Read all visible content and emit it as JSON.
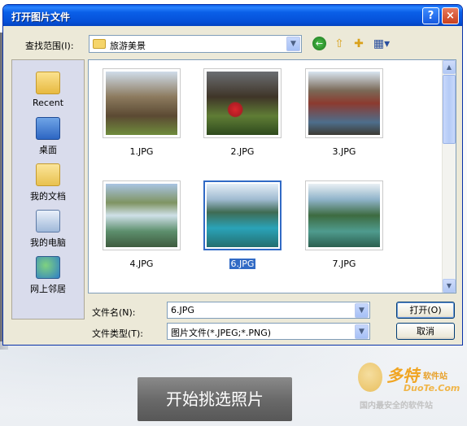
{
  "dialog": {
    "title": "打开图片文件",
    "help_symbol": "?",
    "close_symbol": "×"
  },
  "lookin": {
    "label": "查找范围(I):",
    "value": "旅游美景"
  },
  "places": [
    {
      "label": "Recent",
      "icon": "recent-folder-icon"
    },
    {
      "label": "桌面",
      "icon": "desktop-icon"
    },
    {
      "label": "我的文档",
      "icon": "my-documents-icon"
    },
    {
      "label": "我的电脑",
      "icon": "my-computer-icon"
    },
    {
      "label": "网上邻居",
      "icon": "network-icon"
    }
  ],
  "files": [
    {
      "name": "1.JPG",
      "selected": false
    },
    {
      "name": "2.JPG",
      "selected": false
    },
    {
      "name": "3.JPG",
      "selected": false
    },
    {
      "name": "4.JPG",
      "selected": false
    },
    {
      "name": "6.JPG",
      "selected": true
    },
    {
      "name": "7.JPG",
      "selected": false
    }
  ],
  "filename": {
    "label": "文件名(N):",
    "value": "6.JPG"
  },
  "filetype": {
    "label": "文件类型(T):",
    "value": "图片文件(*.JPEG;*.PNG)"
  },
  "buttons": {
    "open": "打开(O)",
    "cancel": "取消"
  },
  "big_button": "开始挑选照片",
  "watermark": {
    "brand": "多特",
    "sub": "软件站",
    "domain": "DuoTe.Com",
    "slogan": "国内最安全的软件站"
  },
  "colors": {
    "titlebar": "#0a5fe8",
    "selection": "#316ac5",
    "dialog_bg": "#ece9d8"
  }
}
